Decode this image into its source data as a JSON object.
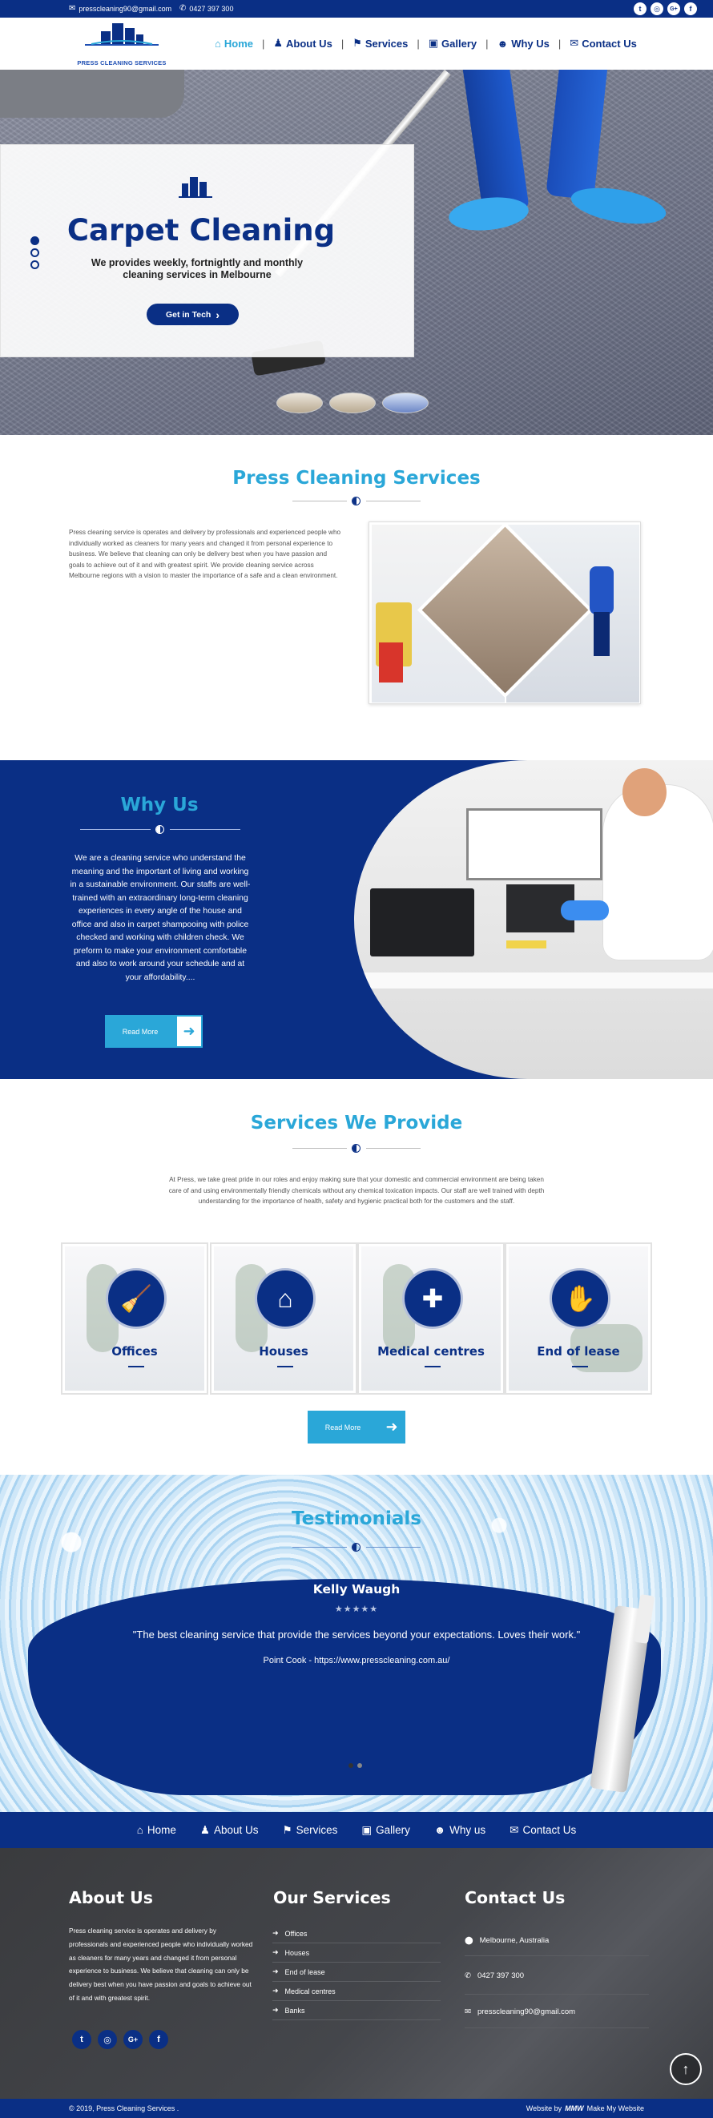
{
  "topbar": {
    "email": "presscleaning90@gmail.com",
    "phone": "0427 397 300",
    "social_icons": [
      "twitter-icon",
      "instagram-icon",
      "google-plus-icon",
      "facebook-icon"
    ],
    "social_glyphs": [
      "t",
      "◎",
      "G+",
      "f"
    ]
  },
  "header": {
    "logo_text": "PRESS CLEANING SERVICES",
    "nav": [
      {
        "label": "Home",
        "icon": "home-icon",
        "glyph": "⌂"
      },
      {
        "label": "About Us",
        "icon": "person-icon",
        "glyph": "♟"
      },
      {
        "label": "Services",
        "icon": "broom-icon",
        "glyph": "⚑"
      },
      {
        "label": "Gallery",
        "icon": "image-icon",
        "glyph": "▣"
      },
      {
        "label": "Why Us",
        "icon": "user-plus-icon",
        "glyph": "☻"
      },
      {
        "label": "Contact Us",
        "icon": "handshake-icon",
        "glyph": "✉"
      }
    ],
    "separator": "|"
  },
  "hero": {
    "title": "Carpet Cleaning",
    "subtitle": "We provides weekly, fortnightly and monthly cleaning services in Melbourne",
    "button": "Get in Tech",
    "button_glyph": "›",
    "slides_active": 1
  },
  "press": {
    "title": "Press Cleaning Services",
    "body": "Press cleaning service is operates and delivery by professionals and experienced people who individually worked as cleaners for many years and changed it from personal experience to business. We believe that cleaning can only be delivery best when you have passion and goals to achieve out of it and with greatest spirit. We provide cleaning service across Melbourne regions with a vision to master the importance of a safe and a clean environment."
  },
  "why": {
    "title": "Why Us",
    "body": "We are a cleaning service who understand the meaning and the important of living and working in a sustainable environment. Our staffs are well-trained with an extraordinary long-term cleaning experiences in every angle of the house and office and also in carpet shampooing with police checked and working with children check. We preform to make your environment comfortable and also to work around your schedule and at your affordability....",
    "button": "Read More",
    "button_glyph": "➜"
  },
  "services": {
    "title": "Services We Provide",
    "intro": "At Press, we take great pride in our roles and enjoy making sure that your domestic and commercial environment are being taken care of and using environmentally friendly chemicals without any chemical toxication impacts. Our staff are well trained with depth understanding for the importance of health, safety and hygienic practical both for the customers and the staff.",
    "cards": [
      {
        "label": "Offices",
        "icon": "cleaner-icon",
        "glyph": "🧹"
      },
      {
        "label": "Houses",
        "icon": "house-icon",
        "glyph": "⌂"
      },
      {
        "label": "Medical centres",
        "icon": "cleaning-supplies-icon",
        "glyph": "✚"
      },
      {
        "label": "End of lease",
        "icon": "glove-icon",
        "glyph": "✋"
      }
    ],
    "button": "Read More",
    "button_glyph": "➜"
  },
  "testimonials": {
    "title": "Testimonials",
    "name": "Kelly Waugh",
    "stars": "★★★★★",
    "quote": "\"The best cleaning service that provide the services beyond your expectations. Loves their work.\"",
    "cite": "Point Cook - https://www.presscleaning.com.au/"
  },
  "footer_nav": [
    {
      "label": "Home",
      "icon": "home-icon",
      "glyph": "⌂"
    },
    {
      "label": "About Us",
      "icon": "person-icon",
      "glyph": "♟"
    },
    {
      "label": "Services",
      "icon": "broom-icon",
      "glyph": "⚑"
    },
    {
      "label": "Gallery",
      "icon": "image-icon",
      "glyph": "▣"
    },
    {
      "label": "Why us",
      "icon": "user-plus-icon",
      "glyph": "☻"
    },
    {
      "label": "Contact Us",
      "icon": "handshake-icon",
      "glyph": "✉"
    }
  ],
  "footer": {
    "about_title": "About Us",
    "about_body": "Press cleaning service is operates and delivery by professionals and experienced people who individually worked as cleaners for many years and changed it from personal experience to business. We believe that cleaning can only be delivery best when you have passion and goals to achieve out of it and with greatest spirit.",
    "social_glyphs": [
      "t",
      "◎",
      "G+",
      "f"
    ],
    "services_title": "Our Services",
    "services": [
      "Offices",
      "Houses",
      "End of lease",
      "Medical centres",
      "Banks"
    ],
    "list_glyph": "➜",
    "contact_title": "Contact Us",
    "address": "Melbourne, Australia",
    "phone": "0427 397 300",
    "email": "presscleaning90@gmail.com",
    "to_top_glyph": "↑"
  },
  "bottom": {
    "copyright": "© 2019, Press Cleaning Services .",
    "credit_prefix": "Website by",
    "credit_logo": "MMW",
    "credit_name": "Make My Website"
  },
  "colors": {
    "brand": "#0a2f85",
    "accent": "#2aa7d8"
  }
}
